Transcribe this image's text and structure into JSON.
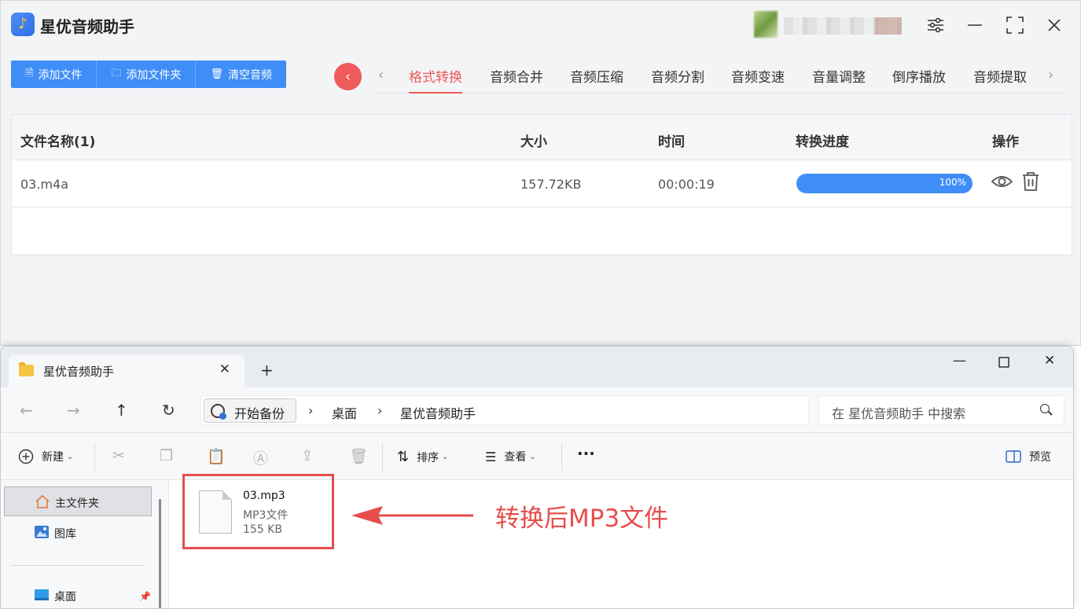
{
  "app": {
    "title": "星优音频助手",
    "toolbar": [
      "添加文件",
      "添加文件夹",
      "清空音频"
    ],
    "tabs": [
      "格式转换",
      "音频合并",
      "音频压缩",
      "音频分割",
      "音频变速",
      "音量调整",
      "倒序播放",
      "音频提取"
    ],
    "active_tab": "格式转换",
    "table": {
      "headers": [
        "文件名称(1)",
        "大小",
        "时间",
        "转换进度",
        "操作"
      ],
      "rows": [
        {
          "name": "03.m4a",
          "size": "157.72KB",
          "time": "00:00:19",
          "progress_label": "100%",
          "progress": 100
        }
      ]
    },
    "colors": {
      "accent": "#3f8ef7",
      "active_tab": "#ef5a5a"
    }
  },
  "explorer": {
    "tab_title": "星优音频助手",
    "address": {
      "chip": "开始备份",
      "crumbs": [
        "桌面",
        "星优音频助手"
      ]
    },
    "search_placeholder": "在 星优音频助手 中搜索",
    "commands": {
      "new": "新建",
      "sort": "排序",
      "view": "查看",
      "more": "···",
      "preview": "预览"
    },
    "sidebar": [
      {
        "label": "主文件夹",
        "icon": "home-icon",
        "selected": true
      },
      {
        "label": "图库",
        "icon": "gallery-icon",
        "selected": false
      },
      {
        "label": "桌面",
        "icon": "desktop-icon",
        "selected": false
      }
    ],
    "file": {
      "name": "03.mp3",
      "type": "MP3文件",
      "size": "155 KB"
    }
  },
  "annotation": {
    "text": "转换后MP3文件",
    "color": "#e74d4d"
  }
}
